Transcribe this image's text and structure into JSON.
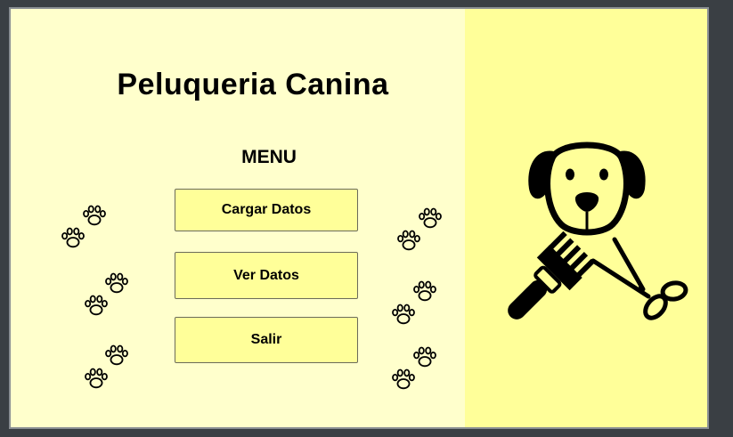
{
  "app": {
    "title": "Peluqueria Canina"
  },
  "menu": {
    "heading": "MENU",
    "buttons": [
      {
        "label": "Cargar Datos"
      },
      {
        "label": "Ver Datos"
      },
      {
        "label": "Salir"
      }
    ]
  },
  "icons": {
    "decoration": "paw-print-icon",
    "illustration": [
      "dog-face-icon",
      "comb-icon",
      "scissors-icon"
    ]
  },
  "colors": {
    "left_panel": "#ffffcc",
    "right_panel": "#ffff99",
    "button_bg": "#ffff99",
    "frame": "#3a3f44"
  }
}
